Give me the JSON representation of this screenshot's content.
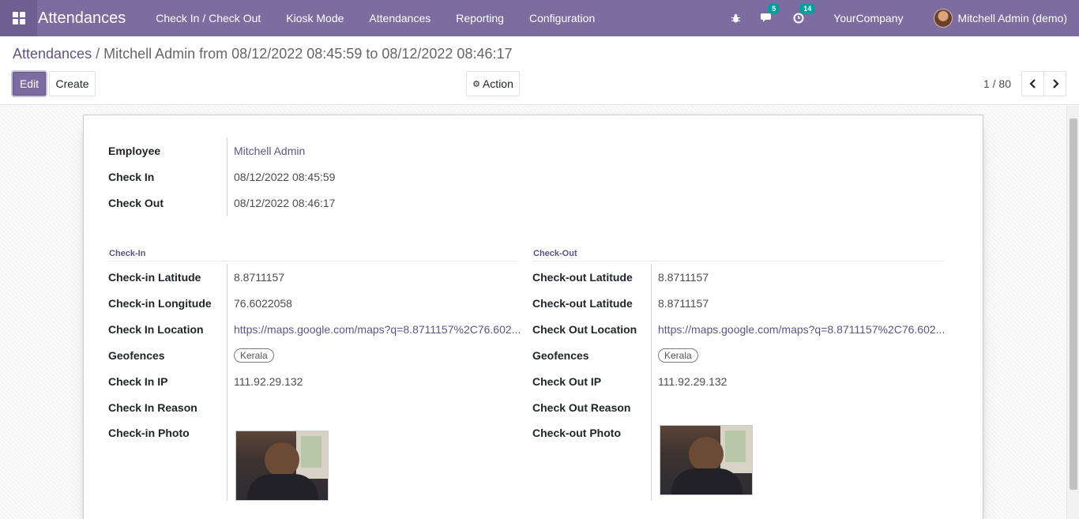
{
  "navbar": {
    "app_name": "Attendances",
    "menu": [
      "Check In / Check Out",
      "Kiosk Mode",
      "Attendances",
      "Reporting",
      "Configuration"
    ],
    "messages_count": "5",
    "activities_count": "14",
    "company": "YourCompany",
    "user": "Mitchell Admin (demo)"
  },
  "breadcrumb": {
    "parent": "Attendances",
    "separator": "/",
    "current": "Mitchell Admin from 08/12/2022 08:45:59 to 08/12/2022 08:46:17"
  },
  "buttons": {
    "edit": "Edit",
    "create": "Create",
    "action": "Action"
  },
  "pager": {
    "value": "1 / 80"
  },
  "main": {
    "employee": {
      "label": "Employee",
      "value": "Mitchell Admin"
    },
    "check_in": {
      "label": "Check In",
      "value": "08/12/2022 08:45:59"
    },
    "check_out": {
      "label": "Check Out",
      "value": "08/12/2022 08:46:17"
    }
  },
  "checkin": {
    "title": "Check-In",
    "latitude": {
      "label": "Check-in Latitude",
      "value": "8.8711157"
    },
    "longitude": {
      "label": "Check-in Longitude",
      "value": "76.6022058"
    },
    "location": {
      "label": "Check In Location",
      "value": "https://maps.google.com/maps?q=8.8711157%2C76.602..."
    },
    "geofences": {
      "label": "Geofences",
      "value": "Kerala"
    },
    "ip": {
      "label": "Check In IP",
      "value": "111.92.29.132"
    },
    "reason": {
      "label": "Check In Reason",
      "value": ""
    },
    "photo": {
      "label": "Check-in Photo"
    }
  },
  "checkout": {
    "title": "Check-Out",
    "latitude": {
      "label": "Check-out Latitude",
      "value": "8.8711157"
    },
    "longitude": {
      "label": "Check-out Latitude",
      "value": "8.8711157"
    },
    "location": {
      "label": "Check Out Location",
      "value": "https://maps.google.com/maps?q=8.8711157%2C76.602..."
    },
    "geofences": {
      "label": "Geofences",
      "value": "Kerala"
    },
    "ip": {
      "label": "Check Out IP",
      "value": "111.92.29.132"
    },
    "reason": {
      "label": "Check Out Reason",
      "value": ""
    },
    "photo": {
      "label": "Check-out Photo"
    }
  },
  "colors": {
    "brand": "#7c6c9f",
    "link": "#5f5484",
    "badge": "#00a09d"
  }
}
